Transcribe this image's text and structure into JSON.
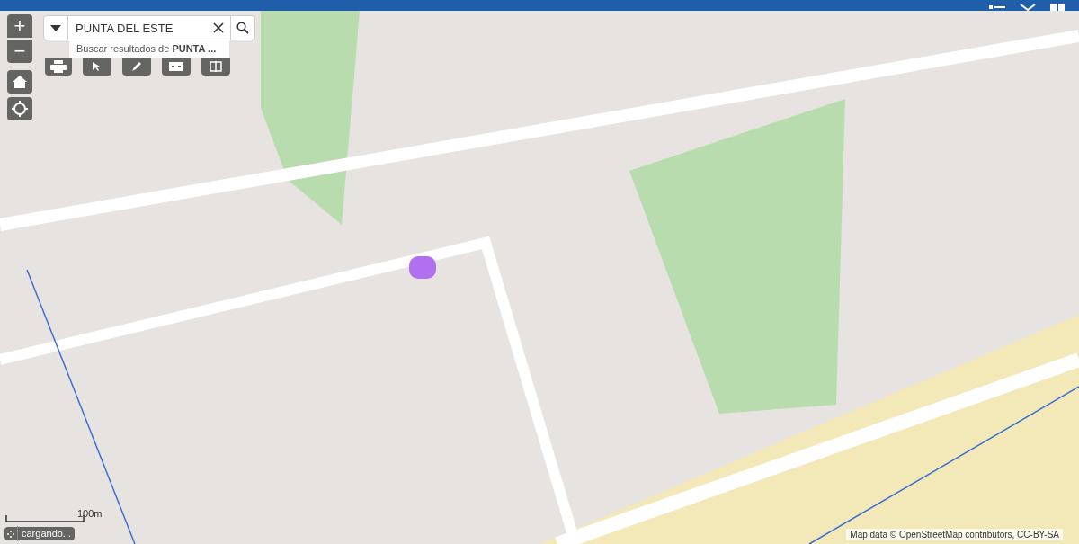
{
  "search": {
    "value": "PUNTA DEL ESTE",
    "suggestion": {
      "prefix": "Buscar resultados de ",
      "query": "PUNTA ..."
    }
  },
  "zoom_controls": {
    "in": "+",
    "out": "−"
  },
  "scale_bar": {
    "label": "100m"
  },
  "status": {
    "text": "cargando..."
  },
  "attribution": "Map data © OpenStreetMap contributors, CC-BY-SA"
}
